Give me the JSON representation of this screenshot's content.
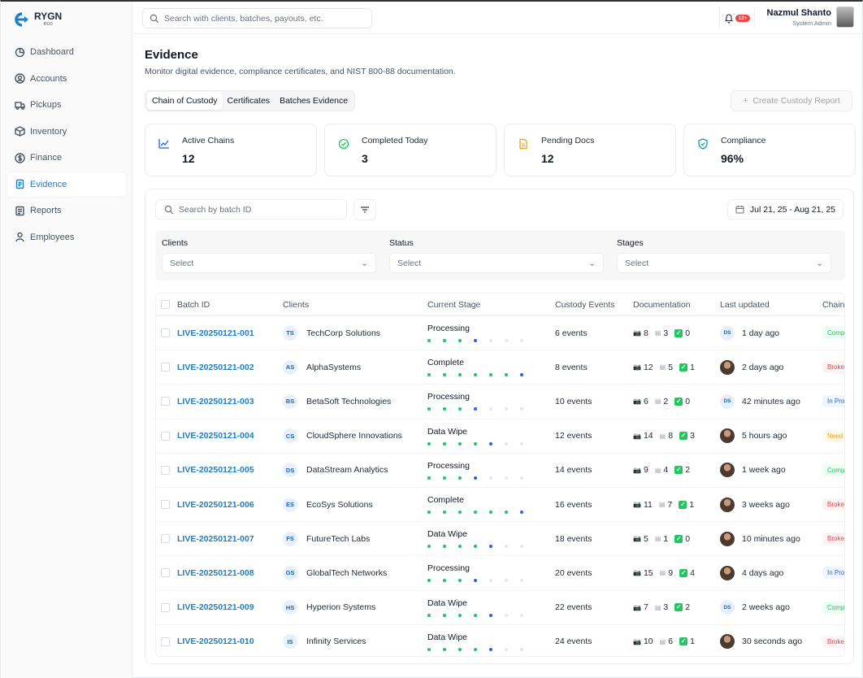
{
  "app": {
    "logo_text": "RYGN",
    "logo_sub": "eco"
  },
  "colors": {
    "accent": "#1d7fc6",
    "green": "#22c55e",
    "blue": "#1d63b0",
    "red": "#ef4444"
  },
  "sidebar": {
    "items": [
      {
        "label": "Dashboard",
        "icon": "dashboard-icon"
      },
      {
        "label": "Accounts",
        "icon": "user-circle-icon"
      },
      {
        "label": "Pickups",
        "icon": "truck-icon"
      },
      {
        "label": "Inventory",
        "icon": "box-icon"
      },
      {
        "label": "Finance",
        "icon": "dollar-icon"
      },
      {
        "label": "Evidence",
        "icon": "document-icon",
        "active": true
      },
      {
        "label": "Reports",
        "icon": "report-icon"
      },
      {
        "label": "Employees",
        "icon": "person-icon"
      }
    ]
  },
  "topbar": {
    "search_placeholder": "Search with clients, batches, payouts, etc.",
    "notification_count": "12+",
    "user_name": "Nazmul Shanto",
    "user_role": "System Admin"
  },
  "page": {
    "title": "Evidence",
    "subtitle": "Monitor digital evidence, compliance certificates, and NIST 800-88 documentation.",
    "tabs": [
      "Chain of Custody",
      "Certificates",
      "Batches Evidence"
    ],
    "active_tab": "Chain of Custody",
    "create_button": "Create Custody Report"
  },
  "stats": [
    {
      "label": "Active Chains",
      "value": "12",
      "icon": "chart-line-icon",
      "color": "#2563eb"
    },
    {
      "label": "Completed Today",
      "value": "3",
      "icon": "check-circle-icon",
      "color": "#22c55e"
    },
    {
      "label": "Pending Docs",
      "value": "12",
      "icon": "file-icon",
      "color": "#f59e0b"
    },
    {
      "label": "Compliance",
      "value": "96%",
      "icon": "shield-check-icon",
      "color": "#0ea5a4"
    }
  ],
  "panel": {
    "search_placeholder": "Search by batch ID",
    "date_range": "Jul 21, 25 - Aug 21, 25",
    "filters": [
      {
        "label": "Clients",
        "value": "Select"
      },
      {
        "label": "Status",
        "value": "Select"
      },
      {
        "label": "Stages",
        "value": "Select"
      }
    ]
  },
  "table": {
    "columns": [
      "Batch ID",
      "Clients",
      "Current Stage",
      "Custody Events",
      "Documentation",
      "Last updated",
      "Chain"
    ],
    "rows": [
      {
        "batch": "LIVE-20250121-001",
        "initials": "TS",
        "client": "TechCorp Solutions",
        "stage": "Processing",
        "progress": 4,
        "events": "6 events",
        "docs": [
          "8",
          "3",
          "0"
        ],
        "updated": "1 day ago",
        "upd_initials": "DS",
        "chain": "Comp",
        "chain_color": "#22c55e",
        "chain_bg": "#ecfdf3"
      },
      {
        "batch": "LIVE-20250121-002",
        "initials": "AS",
        "client": "AlphaSystems",
        "stage": "Complete",
        "progress": 7,
        "events": "8 events",
        "docs": [
          "12",
          "5",
          "1"
        ],
        "updated": "2 days ago",
        "upd_initials": "",
        "chain": "Broke",
        "chain_color": "#ef4444",
        "chain_bg": "#fef2f2"
      },
      {
        "batch": "LIVE-20250121-003",
        "initials": "BS",
        "client": "BetaSoft Technologies",
        "stage": "Processing",
        "progress": 4,
        "events": "10 events",
        "docs": [
          "6",
          "2",
          "0"
        ],
        "updated": "42 minutes ago",
        "upd_initials": "DS",
        "chain": "In Pro",
        "chain_color": "#2563eb",
        "chain_bg": "#eff6ff"
      },
      {
        "batch": "LIVE-20250121-004",
        "initials": "CS",
        "client": "CloudSphere Innovations",
        "stage": "Data Wipe",
        "progress": 5,
        "events": "12 events",
        "docs": [
          "14",
          "8",
          "3"
        ],
        "updated": "5 hours ago",
        "upd_initials": "",
        "chain": "Need",
        "chain_color": "#f59e0b",
        "chain_bg": "#fffbeb"
      },
      {
        "batch": "LIVE-20250121-005",
        "initials": "DS",
        "client": "DataStream Analytics",
        "stage": "Processing",
        "progress": 4,
        "events": "14 events",
        "docs": [
          "9",
          "4",
          "2"
        ],
        "updated": "1 week ago",
        "upd_initials": "",
        "chain": "Comp",
        "chain_color": "#22c55e",
        "chain_bg": "#ecfdf3"
      },
      {
        "batch": "LIVE-20250121-006",
        "initials": "ES",
        "client": "EcoSys Solutions",
        "stage": "Complete",
        "progress": 7,
        "events": "16 events",
        "docs": [
          "11",
          "7",
          "1"
        ],
        "updated": "3 weeks ago",
        "upd_initials": "",
        "chain": "Broke",
        "chain_color": "#ef4444",
        "chain_bg": "#fef2f2"
      },
      {
        "batch": "LIVE-20250121-007",
        "initials": "FS",
        "client": "FutureTech Labs",
        "stage": "Data Wipe",
        "progress": 5,
        "events": "18 events",
        "docs": [
          "5",
          "1",
          "0"
        ],
        "updated": "10 minutes ago",
        "upd_initials": "",
        "chain": "Broke",
        "chain_color": "#ef4444",
        "chain_bg": "#fef2f2"
      },
      {
        "batch": "LIVE-20250121-008",
        "initials": "GS",
        "client": "GlobalTech Networks",
        "stage": "Processing",
        "progress": 4,
        "events": "20 events",
        "docs": [
          "15",
          "9",
          "4"
        ],
        "updated": "4 days ago",
        "upd_initials": "",
        "chain": "In Pro",
        "chain_color": "#2563eb",
        "chain_bg": "#eff6ff"
      },
      {
        "batch": "LIVE-20250121-009",
        "initials": "HS",
        "client": "Hyperion Systems",
        "stage": "Data Wipe",
        "progress": 5,
        "events": "22 events",
        "docs": [
          "7",
          "3",
          "2"
        ],
        "updated": "2 weeks ago",
        "upd_initials": "DS",
        "chain": "Comp",
        "chain_color": "#22c55e",
        "chain_bg": "#ecfdf3"
      },
      {
        "batch": "LIVE-20250121-010",
        "initials": "IS",
        "client": "Infinity Services",
        "stage": "Data Wipe",
        "progress": 5,
        "events": "24 events",
        "docs": [
          "10",
          "6",
          "1"
        ],
        "updated": "30 seconds ago",
        "upd_initials": "",
        "chain": "Broke",
        "chain_color": "#ef4444",
        "chain_bg": "#fef2f2"
      }
    ]
  }
}
